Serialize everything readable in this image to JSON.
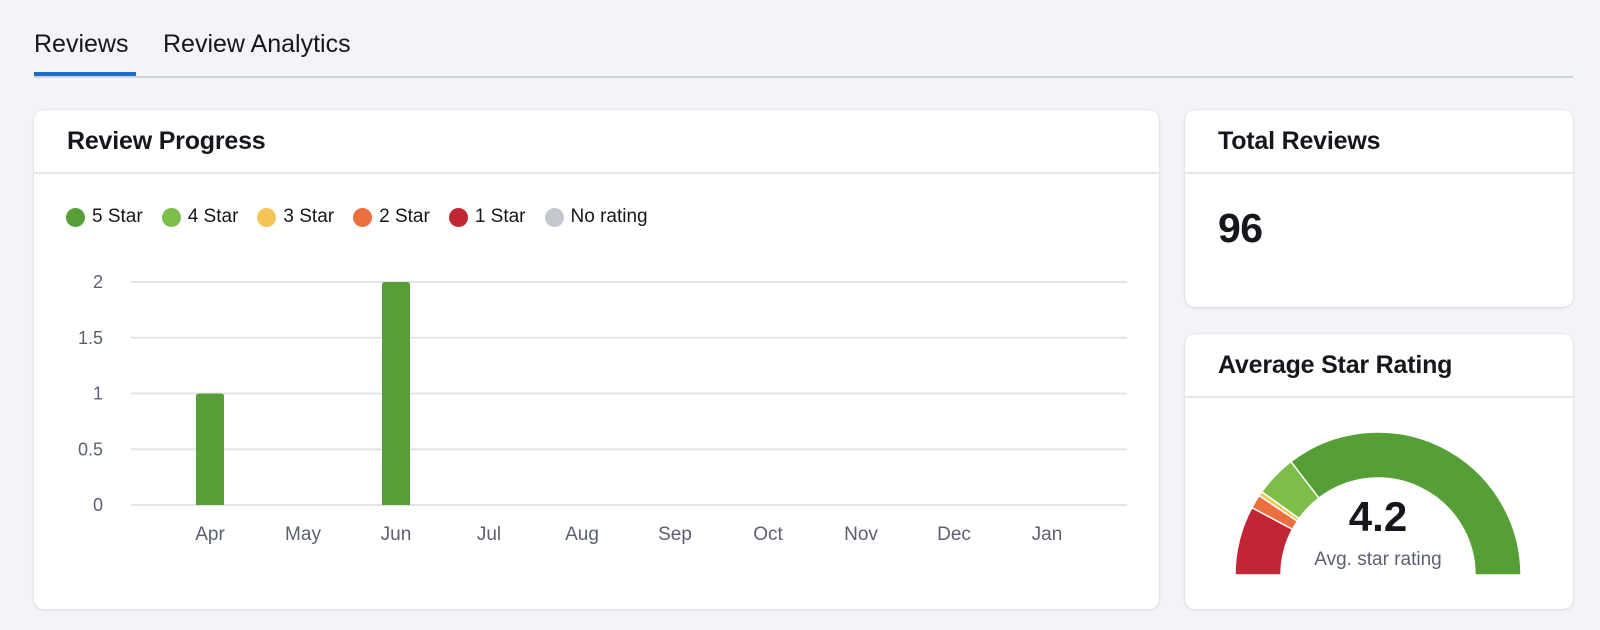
{
  "tabs": [
    {
      "label": "Reviews",
      "active": true
    },
    {
      "label": "Review Analytics",
      "active": false
    }
  ],
  "review_progress": {
    "title": "Review Progress",
    "legend": [
      {
        "label": "5 Star",
        "color": "#569f37"
      },
      {
        "label": "4 Star",
        "color": "#7dbd4a"
      },
      {
        "label": "3 Star",
        "color": "#f5c558"
      },
      {
        "label": "2 Star",
        "color": "#ec6f3f"
      },
      {
        "label": "1 Star",
        "color": "#c12634"
      },
      {
        "label": "No rating",
        "color": "#c5c8cf"
      }
    ]
  },
  "total_reviews": {
    "title": "Total Reviews",
    "value": "96"
  },
  "average_rating": {
    "title": "Average Star Rating",
    "value": "4.2",
    "label": "Avg. star rating"
  },
  "chart_data": [
    {
      "type": "bar",
      "title": "Review Progress",
      "xlabel": "",
      "ylabel": "",
      "categories": [
        "Apr",
        "May",
        "Jun",
        "Jul",
        "Aug",
        "Sep",
        "Oct",
        "Nov",
        "Dec",
        "Jan"
      ],
      "yticks": [
        "0",
        "0.5",
        "1",
        "1.5",
        "2"
      ],
      "ylim": [
        0,
        2
      ],
      "grid": true,
      "legend_position": "top-left",
      "stacked": true,
      "series": [
        {
          "name": "5 Star",
          "color": "#569f37",
          "values": [
            1,
            0,
            2,
            0,
            0,
            0,
            0,
            0,
            0,
            0
          ]
        },
        {
          "name": "4 Star",
          "color": "#7dbd4a",
          "values": [
            0,
            0,
            0,
            0,
            0,
            0,
            0,
            0,
            0,
            0
          ]
        },
        {
          "name": "3 Star",
          "color": "#f5c558",
          "values": [
            0,
            0,
            0,
            0,
            0,
            0,
            0,
            0,
            0,
            0
          ]
        },
        {
          "name": "2 Star",
          "color": "#ec6f3f",
          "values": [
            0,
            0,
            0,
            0,
            0,
            0,
            0,
            0,
            0,
            0
          ]
        },
        {
          "name": "1 Star",
          "color": "#c12634",
          "values": [
            0,
            0,
            0,
            0,
            0,
            0,
            0,
            0,
            0,
            0
          ]
        },
        {
          "name": "No rating",
          "color": "#c5c8cf",
          "values": [
            0,
            0,
            0,
            0,
            0,
            0,
            0,
            0,
            0,
            0
          ]
        }
      ]
    },
    {
      "type": "pie",
      "subtype": "half-donut-gauge",
      "title": "Average Star Rating",
      "center_value": "4.2",
      "center_label": "Avg. star rating",
      "slices": [
        {
          "name": "1 Star",
          "color": "#c12634",
          "value": 15
        },
        {
          "name": "2 Star",
          "color": "#ec6f3f",
          "value": 3
        },
        {
          "name": "3 Star",
          "color": "#f5c558",
          "value": 1
        },
        {
          "name": "4 Star",
          "color": "#7dbd4a",
          "value": 9
        },
        {
          "name": "5 Star",
          "color": "#569f37",
          "value": 68
        }
      ]
    }
  ]
}
